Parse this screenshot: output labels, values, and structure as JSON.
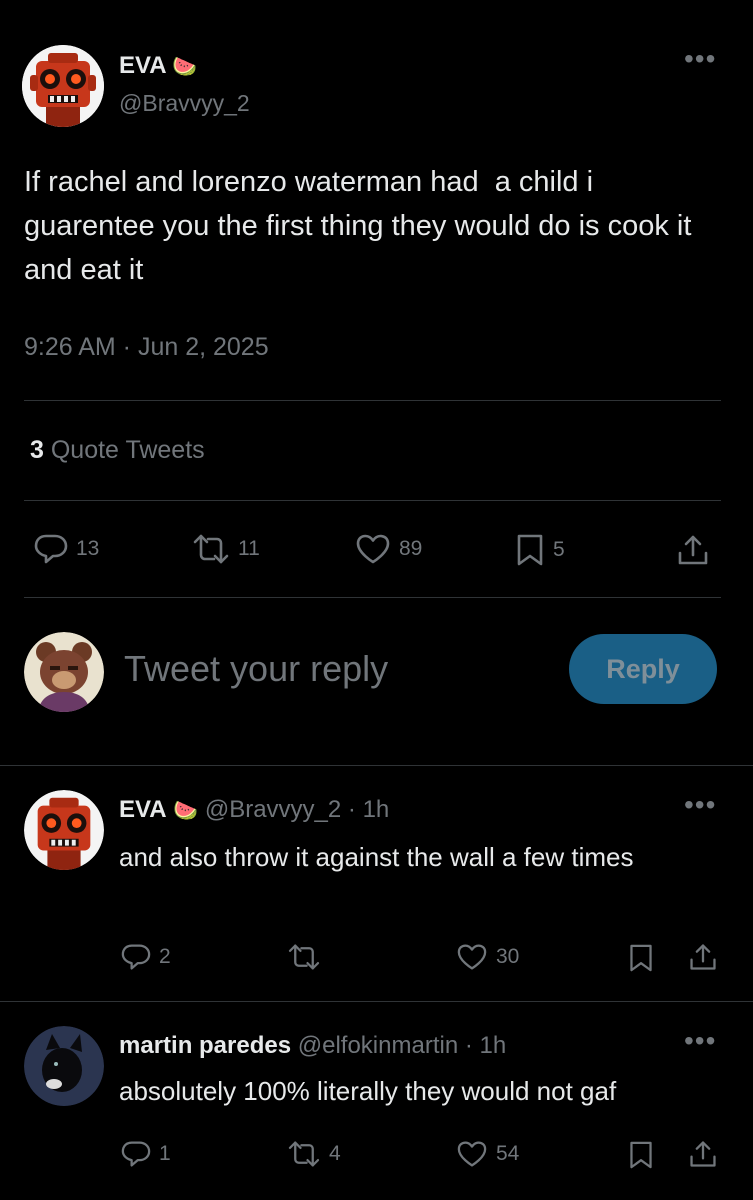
{
  "tweet": {
    "author_name": "EVA",
    "author_emoji": "🍉",
    "handle": "@Bravvyy_2",
    "text": "If rachel and lorenzo waterman had  a child i guarentee you the first thing they would do is cook it and eat it",
    "timestamp": "9:26 AM · Jun 2, 2025",
    "quote_count": "3",
    "quote_label": "Quote Tweets",
    "replies": "13",
    "retweets": "11",
    "likes": "89",
    "bookmarks": "5"
  },
  "composer": {
    "placeholder": "Tweet your reply",
    "reply_button": "Reply"
  },
  "replies": [
    {
      "name": "EVA",
      "emoji": "🍉",
      "handle": "@Bravvyy_2",
      "time": "· 1h",
      "text": "and also throw it against the wall a few times",
      "replies": "2",
      "retweets": "",
      "likes": "30"
    },
    {
      "name": "martin paredes",
      "emoji": "",
      "handle": "@elfokinmartin",
      "time": "· 1h",
      "text": "absolutely 100% literally they would not gaf",
      "replies": "1",
      "retweets": "4",
      "likes": "54"
    }
  ],
  "colors": {
    "background": "#000000",
    "text": "#e7e9ea",
    "muted": "#71767b",
    "divider": "#2f3336",
    "reply_button": "#1a5f86"
  },
  "icons": [
    "avatar-robot",
    "avatar-bear",
    "avatar-dog",
    "more-icon",
    "reply-icon",
    "retweet-icon",
    "like-icon",
    "bookmark-icon",
    "share-icon"
  ]
}
